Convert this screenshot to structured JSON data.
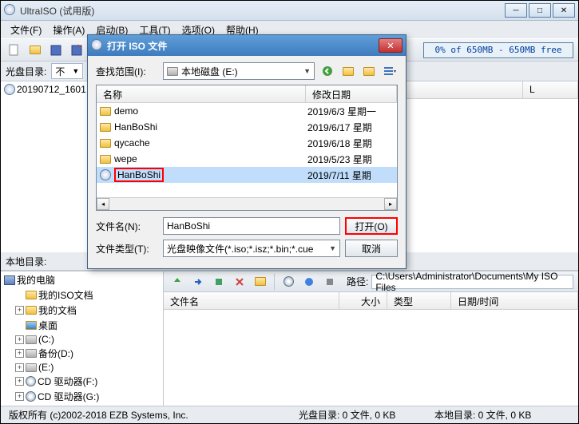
{
  "window": {
    "title": "UltraISO (试用版)",
    "controls": {
      "min": "─",
      "max": "□",
      "close": "✕"
    }
  },
  "menu": {
    "file": "文件(F)",
    "action": "操作(A)",
    "boot": "启动(B)",
    "tools": "工具(T)",
    "options": "选项(O)",
    "help": "帮助(H)"
  },
  "capacity": "0% of 650MB - 650MB free",
  "iso_section": {
    "label": "光盘目录:",
    "tree_root": "20190712_1601",
    "combo_prefix": "不"
  },
  "columns": {
    "name": "文件名",
    "size": "大小",
    "type": "类型",
    "date": "日期/时间",
    "l": "L",
    "name2": "名称",
    "moddate": "修改日期"
  },
  "local_section": {
    "label": "本地目录:",
    "path_label": "路径:",
    "path": "C:\\Users\\Administrator\\Documents\\My ISO Files",
    "tree": {
      "computer": "我的电脑",
      "iso_docs": "我的ISO文档",
      "my_docs": "我的文档",
      "desktop": "桌面",
      "c": "(C:)",
      "backup_d": "备份(D:)",
      "e": "(E:)",
      "cd_f": "CD 驱动器(F:)",
      "cd_g": "CD 驱动器(G:)"
    }
  },
  "statusbar": {
    "copyright": "版权所有 (c)2002-2018 EZB Systems, Inc.",
    "iso_info": "光盘目录: 0 文件, 0 KB",
    "local_info": "本地目录: 0 文件, 0 KB"
  },
  "dialog": {
    "title": "打开 ISO 文件",
    "lookin": "查找范围(I):",
    "drive": "本地磁盘 (E:)",
    "files": [
      {
        "name": "demo",
        "date": "2019/6/3 星期一",
        "type": "folder"
      },
      {
        "name": "HanBoShi",
        "date": "2019/6/17 星期",
        "type": "folder"
      },
      {
        "name": "qycache",
        "date": "2019/6/18 星期",
        "type": "folder"
      },
      {
        "name": "wepe",
        "date": "2019/5/23 星期",
        "type": "folder"
      },
      {
        "name": "HanBoShi",
        "date": "2019/7/11 星期",
        "type": "iso",
        "selected": true,
        "highlight": true
      }
    ],
    "filename_label": "文件名(N):",
    "filename_value": "HanBoShi",
    "filetype_label": "文件类型(T):",
    "filetype_value": "光盘映像文件(*.iso;*.isz;*.bin;*.cue",
    "open_btn": "打开(O)",
    "cancel_btn": "取消"
  }
}
